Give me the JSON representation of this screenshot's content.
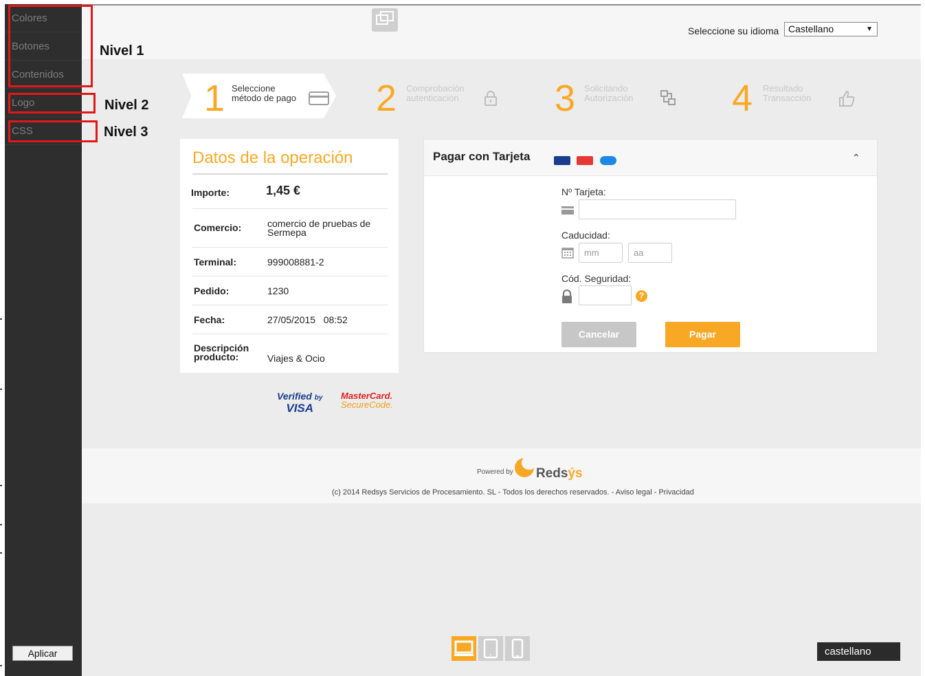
{
  "sidebar": {
    "items": [
      {
        "label": "Colores"
      },
      {
        "label": "Botones"
      },
      {
        "label": "Contenidos"
      },
      {
        "label": "Logo"
      },
      {
        "label": "CSS"
      }
    ],
    "apply_label": "Aplicar"
  },
  "annotations": {
    "level1": "Nivel 1",
    "level2": "Nivel 2",
    "level3": "Nivel 3",
    "box_color": "#e01818"
  },
  "header": {
    "lang_label": "Seleccione su idioma",
    "lang_value": "Castellano"
  },
  "steps": [
    {
      "num": "1",
      "line1": "Seleccione",
      "line2": "método de pago",
      "icon": "credit-card-icon"
    },
    {
      "num": "2",
      "line1": "Comprobación",
      "line2": "autenticación",
      "icon": "lock-icon"
    },
    {
      "num": "3",
      "line1": "Solicitando",
      "line2": "Autorización",
      "icon": "connection-icon"
    },
    {
      "num": "4",
      "line1": "Resultado",
      "line2": "Transacción",
      "icon": "thumbs-up-icon"
    }
  ],
  "datos": {
    "title": "Datos de la operación",
    "importe_label": "Importe:",
    "importe_value": "1,45 €",
    "rows": [
      {
        "label": "Comercio:",
        "value": "comercio de pruebas de Sermepa"
      },
      {
        "label": "Terminal:",
        "value": "999008881-2"
      },
      {
        "label": "Pedido:",
        "value": "1230"
      },
      {
        "label": "Fecha:",
        "value": "27/05/2015   08:52"
      },
      {
        "label": "Descripción producto:",
        "value": "Viajes & Ocio"
      }
    ]
  },
  "badges": {
    "visa_line1": "Verified",
    "visa_by": "by",
    "visa_line2": "VISA",
    "mc_line1": "MasterCard.",
    "mc_line2": "SecureCode."
  },
  "pay": {
    "title": "Pagar con Tarjeta",
    "card_label": "Nº Tarjeta:",
    "expiry_label": "Caducidad:",
    "mm_placeholder": "mm",
    "aa_placeholder": "aa",
    "cvv_label": "Cód. Seguridad:",
    "help_glyph": "?",
    "cancel_label": "Cancelar",
    "pay_label": "Pagar"
  },
  "footer": {
    "powered_by": "Powered by",
    "brand_a": "Reds",
    "brand_b": "ýs",
    "copyright": "(c) 2014 Redsys Servicios de Procesamiento. SL - Todos los derechos reservados. -  Aviso legal -  Privacidad"
  },
  "device_bar": {
    "selected": "desktop",
    "language": "castellano"
  },
  "colors": {
    "accent": "#f9a825",
    "sidebar_bg": "#2e2e2e",
    "cancel_bg": "#c7c7c7",
    "page_bg": "#ececec"
  }
}
